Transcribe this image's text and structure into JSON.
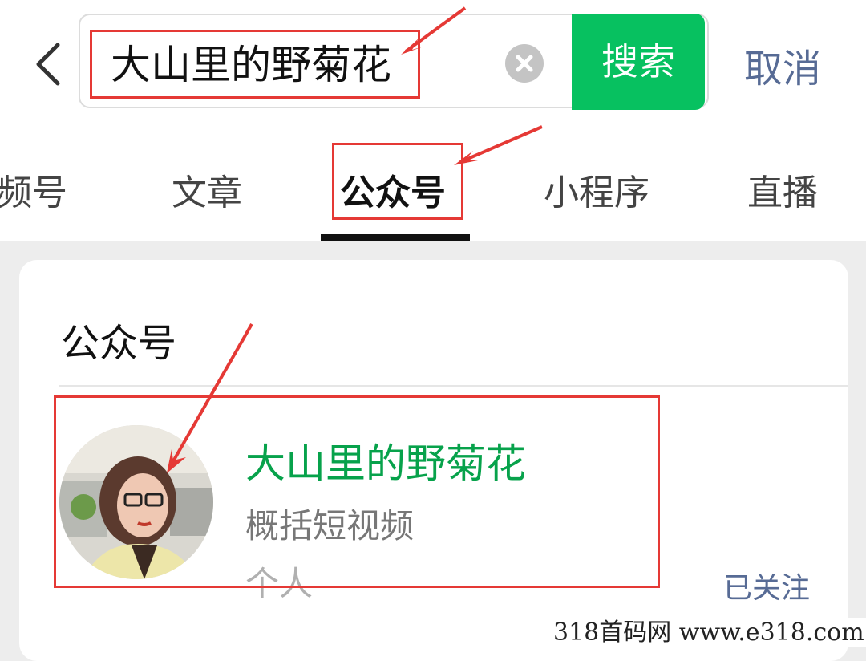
{
  "header": {
    "back_icon": "chevron-left-icon",
    "search_query": "大山里的野菊花",
    "clear_icon": "clear-circle-icon",
    "search_label": "搜索",
    "cancel_label": "取消"
  },
  "tabs": [
    {
      "label": "视频号",
      "visible_text": "频号"
    },
    {
      "label": "文章"
    },
    {
      "label": "公众号",
      "active": true
    },
    {
      "label": "小程序"
    },
    {
      "label": "直播"
    }
  ],
  "results": {
    "section_title": "公众号",
    "account": {
      "name": "大山里的野菊花",
      "description": "概括短视频",
      "type": "个人",
      "follow_status": "已关注"
    }
  },
  "watermark": "318首码网  www.e318.com",
  "colors": {
    "brand_green": "#07c160",
    "name_green": "#07a24b",
    "link_blue": "#576b95",
    "annotation_red": "#e53935"
  }
}
